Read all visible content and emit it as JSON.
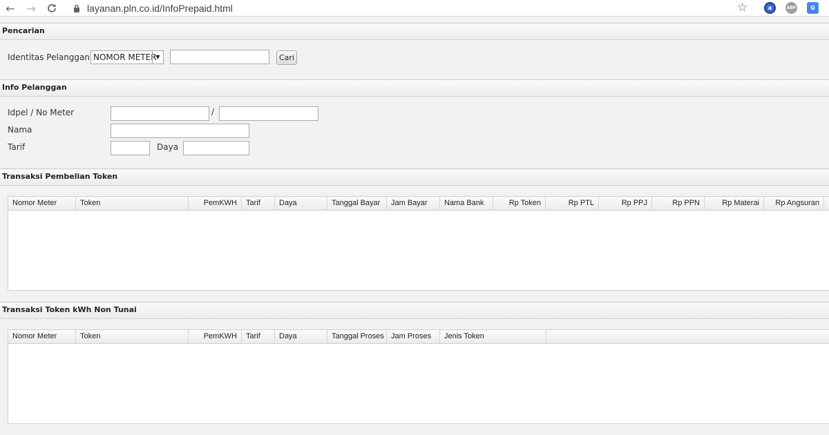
{
  "browser": {
    "url": "layanan.pln.co.id/InfoPrepaid.html",
    "extensions": [
      {
        "name": "ext-blue",
        "text": "a",
        "color": "#3b6bd6"
      },
      {
        "name": "adblock-plus",
        "text": "ABP",
        "color": "#9e9e9e"
      },
      {
        "name": "translate",
        "text": "G",
        "color": "#4a86e8"
      }
    ]
  },
  "pencarian": {
    "title": "Pencarian",
    "identity_label": "Identitas Pelanggan",
    "select_value": "NOMOR METER",
    "search_value": "",
    "search_button": "Cari"
  },
  "info": {
    "title": "Info Pelanggan",
    "idpel_label": "Idpel / No Meter",
    "separator": "/",
    "nama_label": "Nama",
    "tarif_label": "Tarif",
    "daya_label": "Daya"
  },
  "pembelian": {
    "title": "Transaksi Pembelian Token",
    "columns": [
      "Nomor Meter",
      "Token",
      "PemKWH",
      "Tarif",
      "Daya",
      "Tanggal Bayar",
      "Jam Bayar",
      "Nama Bank",
      "Rp Token",
      "Rp PTL",
      "Rp PPJ",
      "Rp PPN",
      "Rp Materai",
      "Rp Angsuran"
    ]
  },
  "nontunai": {
    "title": "Transaksi Token kWh Non Tunai",
    "columns": [
      "Nomor Meter",
      "Token",
      "PemKWH",
      "Tarif",
      "Daya",
      "Tanggal Proses",
      "Jam Proses",
      "Jenis Token"
    ]
  }
}
